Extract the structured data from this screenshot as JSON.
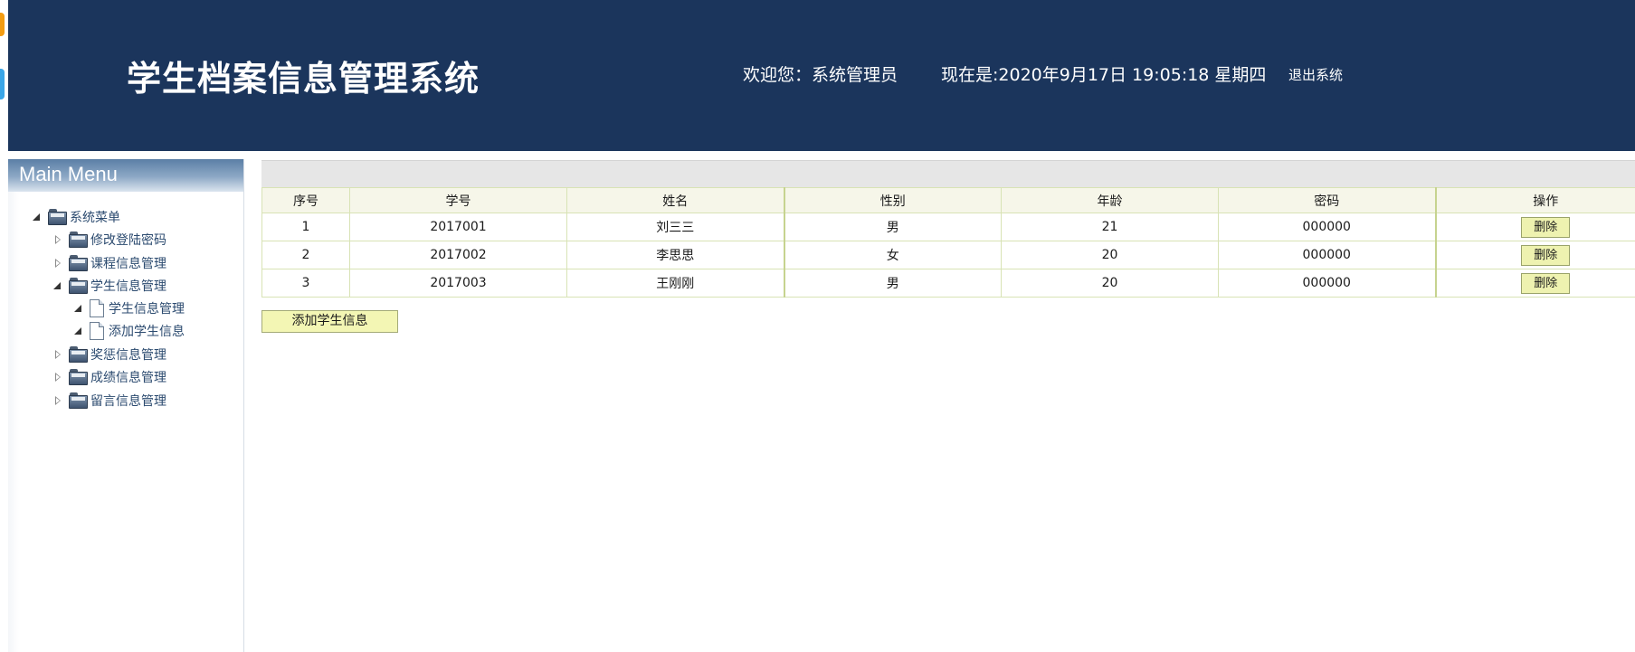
{
  "colors": {
    "header_bg": "#1b355c",
    "accent_button": "#f3f6b4",
    "table_header_bg": "#f6f6e9",
    "tree_text": "#2b4a6f"
  },
  "header": {
    "title": "学生档案信息管理系统",
    "welcome": "欢迎您：系统管理员",
    "clock": "现在是:2020年9月17日 19:05:18 星期四",
    "logout": "退出系统"
  },
  "sidebar": {
    "heading": "Main Menu",
    "tree": {
      "root": {
        "label": "系统菜单",
        "icon": "folder-icon",
        "expanded": true
      },
      "items": [
        {
          "label": "修改登陆密码",
          "icon": "folder-icon",
          "expanded": false
        },
        {
          "label": "课程信息管理",
          "icon": "folder-icon",
          "expanded": false
        },
        {
          "label": "学生信息管理",
          "icon": "folder-icon",
          "expanded": true,
          "children": [
            {
              "label": "学生信息管理",
              "icon": "file-icon"
            },
            {
              "label": "添加学生信息",
              "icon": "file-icon"
            }
          ]
        },
        {
          "label": "奖惩信息管理",
          "icon": "folder-icon",
          "expanded": false
        },
        {
          "label": "成绩信息管理",
          "icon": "folder-icon",
          "expanded": false
        },
        {
          "label": "留言信息管理",
          "icon": "folder-icon",
          "expanded": false
        }
      ]
    }
  },
  "table": {
    "columns": [
      "序号",
      "学号",
      "姓名",
      "性别",
      "年龄",
      "密码",
      "操作"
    ],
    "rows": [
      {
        "index": "1",
        "student_id": "2017001",
        "name": "刘三三",
        "gender": "男",
        "age": "21",
        "password": "000000",
        "action": "删除"
      },
      {
        "index": "2",
        "student_id": "2017002",
        "name": "李思思",
        "gender": "女",
        "age": "20",
        "password": "000000",
        "action": "删除"
      },
      {
        "index": "3",
        "student_id": "2017003",
        "name": "王刚刚",
        "gender": "男",
        "age": "20",
        "password": "000000",
        "action": "删除"
      }
    ]
  },
  "add_button": "添加学生信息"
}
